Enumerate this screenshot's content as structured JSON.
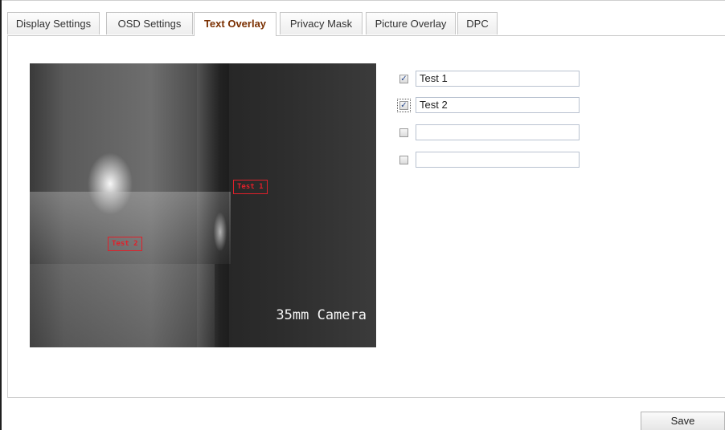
{
  "tabs": [
    {
      "label": "Display Settings",
      "active": false
    },
    {
      "label": "OSD Settings",
      "active": false
    },
    {
      "label": "Text Overlay",
      "active": true
    },
    {
      "label": "Privacy Mask",
      "active": false
    },
    {
      "label": "Picture Overlay",
      "active": false
    },
    {
      "label": "DPC",
      "active": false
    }
  ],
  "preview": {
    "camera_label": "35mm Camera",
    "overlay_boxes": [
      {
        "label": "Test 1"
      },
      {
        "label": "Test 2"
      }
    ]
  },
  "overlays": [
    {
      "checked": true,
      "value": "Test 1"
    },
    {
      "checked": true,
      "value": "Test 2"
    },
    {
      "checked": false,
      "value": ""
    },
    {
      "checked": false,
      "value": ""
    }
  ],
  "colors": {
    "active_tab_text": "#7a2f00",
    "overlay_box": "#e0202a"
  },
  "actions": {
    "save_label": "Save"
  }
}
